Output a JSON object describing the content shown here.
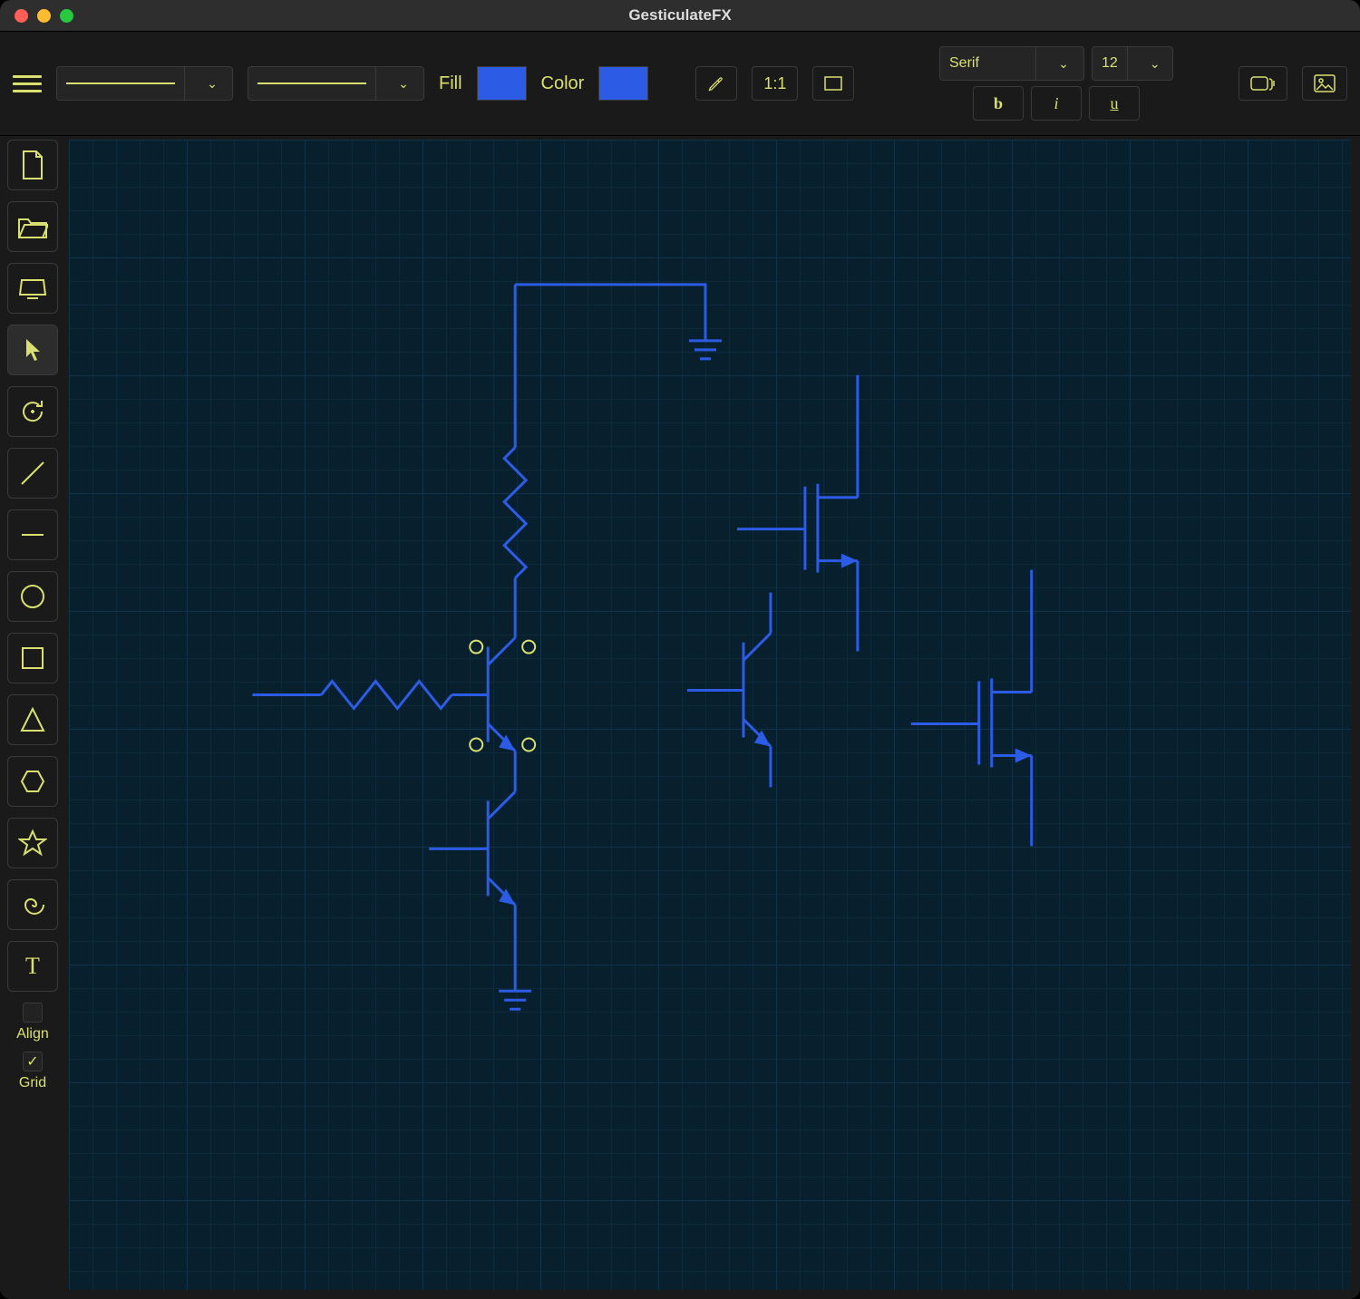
{
  "window": {
    "title": "GesticulateFX"
  },
  "toolbar": {
    "fill_label": "Fill",
    "color_label": "Color",
    "fill_swatch": "#2c5ce6",
    "color_swatch": "#2c5ce6",
    "ratio_label": "1:1",
    "font_family": "Serif",
    "font_size": "12",
    "bold_label": "b",
    "italic_label": "i",
    "underline_label": "u"
  },
  "sidebar": {
    "align": {
      "label": "Align",
      "checked": false
    },
    "grid": {
      "label": "Grid",
      "checked": true
    }
  },
  "tools": {
    "active": "pointer"
  },
  "canvas": {
    "accent_color": "#2c5ce6",
    "node_color": "#d9e070"
  }
}
